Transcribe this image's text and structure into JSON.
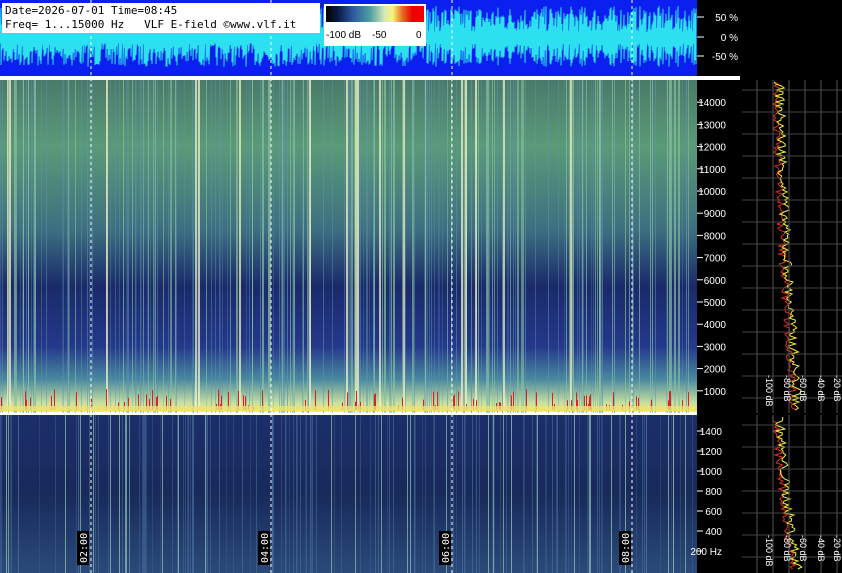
{
  "header": {
    "line1": "Date=2026-07-01 Time=08:45",
    "line2": "Freq= 1...15000 Hz   VLF E-field ©www.vlf.it"
  },
  "colorbar": {
    "labels": [
      "-100 dB",
      "-50",
      "0"
    ]
  },
  "chart_data": [
    {
      "type": "line",
      "name": "waveform",
      "ylabel_ticks": [
        "50 %",
        "0 %",
        "-50 %"
      ],
      "ylim": [
        -100,
        100
      ],
      "background": "#0a1ff0",
      "line_color": "#2de0f0"
    },
    {
      "type": "heatmap",
      "name": "spectrogram-full",
      "y_ticks": [
        "14000",
        "13000",
        "12000",
        "11000",
        "10000",
        "9000",
        "8000",
        "7000",
        "6000",
        "5000",
        "4000",
        "3000",
        "2000",
        "1000"
      ],
      "ylim": [
        0,
        15000
      ],
      "spectrum_ticks": [
        "-100 dB",
        "-80 dB",
        "-60 dB",
        "-40 dB",
        "-20 dB"
      ]
    },
    {
      "type": "heatmap",
      "name": "spectrogram-low",
      "y_ticks": [
        "1400",
        "1200",
        "1000",
        "800",
        "600",
        "400",
        "200 Hz"
      ],
      "ylim": [
        0,
        1500
      ],
      "x_ticks": [
        "02:00",
        "04:00",
        "06:00",
        "08:00"
      ],
      "spectrum_ticks": [
        "-100 dB",
        "-80 dB",
        "-60 dB",
        "-40 dB",
        "-20 dB"
      ]
    }
  ]
}
